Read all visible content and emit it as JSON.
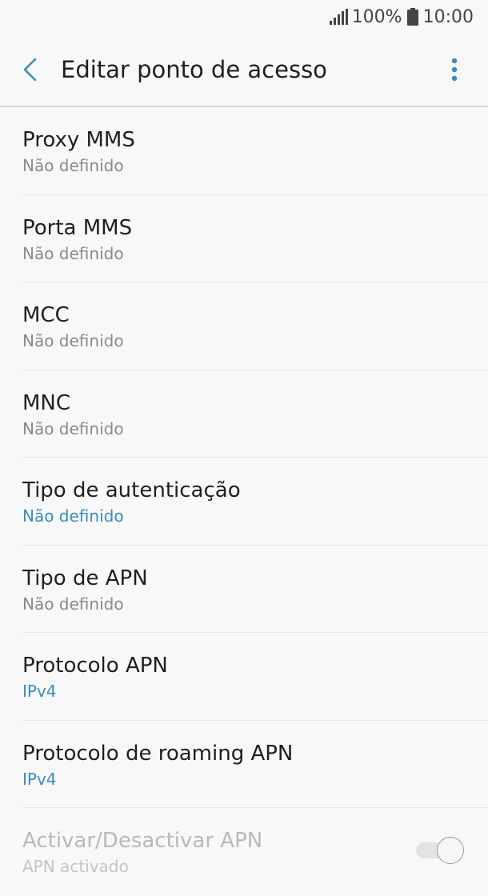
{
  "status_bar": {
    "battery": "100%",
    "time": "10:00",
    "icons": [
      "signal-icon",
      "battery-icon"
    ]
  },
  "header": {
    "title": "Editar ponto de acesso",
    "icons": [
      "back-arrow-icon",
      "more-vert-icon"
    ],
    "accent_color": "#3a8bbd"
  },
  "settings": [
    {
      "title": "Proxy MMS",
      "summary": "Não definido",
      "accent": false
    },
    {
      "title": "Porta MMS",
      "summary": "Não definido",
      "accent": false
    },
    {
      "title": "MCC",
      "summary": "Não definido",
      "accent": false
    },
    {
      "title": "MNC",
      "summary": "Não definido",
      "accent": false
    },
    {
      "title": "Tipo de autenticação",
      "summary": "Não definido",
      "accent": true
    },
    {
      "title": "Tipo de APN",
      "summary": "Não definido",
      "accent": false
    },
    {
      "title": "Protocolo APN",
      "summary": "IPv4",
      "accent": true
    },
    {
      "title": "Protocolo de roaming APN",
      "summary": "IPv4",
      "accent": true
    },
    {
      "title": "Activar/Desactivar APN",
      "summary": "APN activado",
      "disabled": true,
      "switch_on": false
    }
  ]
}
